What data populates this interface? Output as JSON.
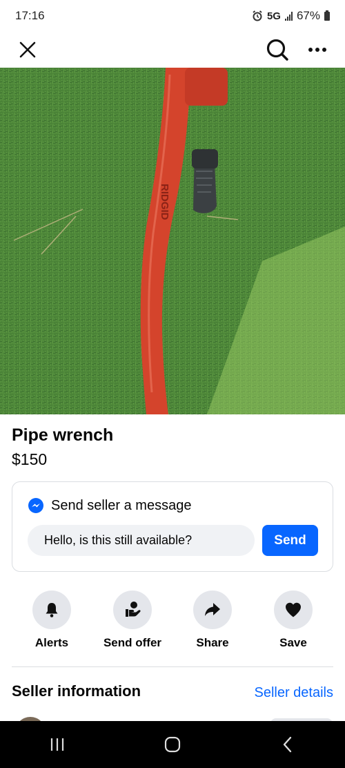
{
  "status_bar": {
    "time": "17:16",
    "network": "5G",
    "battery": "67%"
  },
  "top_bar": {
    "close_icon": "close-icon",
    "search_icon": "search-icon",
    "more_icon": "more-icon"
  },
  "listing": {
    "photo_icon": "pipe-wrench-photo",
    "title": "Pipe wrench",
    "price": "$150"
  },
  "message": {
    "heading": "Send seller a message",
    "input_value": "Hello, is this still available?",
    "send_label": "Send"
  },
  "actions": [
    {
      "label": "Alerts",
      "icon": "bell-icon"
    },
    {
      "label": "Send offer",
      "icon": "offer-icon"
    },
    {
      "label": "Share",
      "icon": "share-icon"
    },
    {
      "label": "Save",
      "icon": "heart-icon"
    }
  ],
  "seller": {
    "heading": "Seller information",
    "details_link": "Seller details"
  },
  "colors": {
    "accent": "#0866ff",
    "chip_bg": "#e4e6eb",
    "input_bg": "#f0f2f5"
  }
}
